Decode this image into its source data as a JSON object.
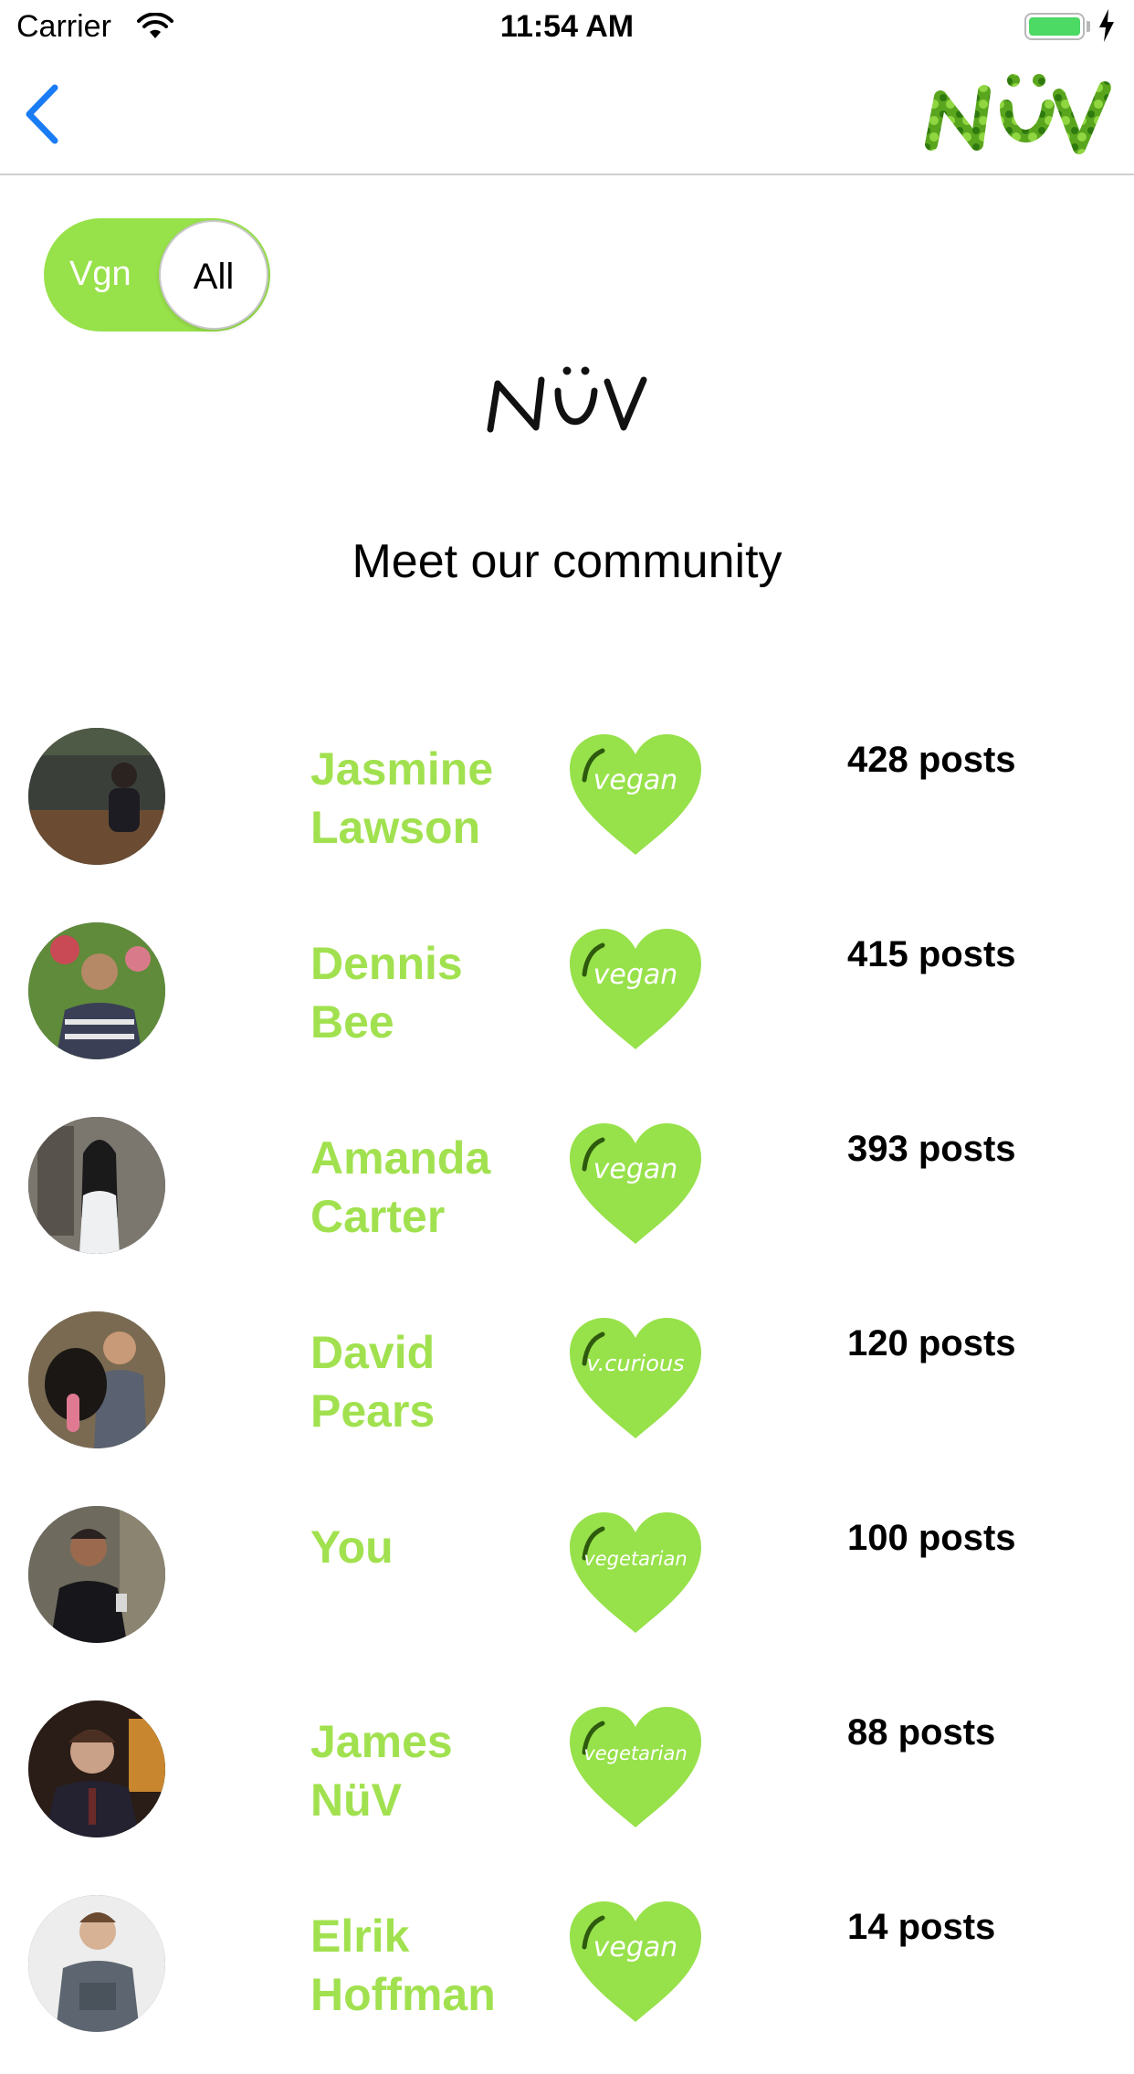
{
  "status_bar": {
    "carrier": "Carrier",
    "time": "11:54 AM"
  },
  "nav": {
    "logo_text": "NüV",
    "back_icon": "chevron-left-icon"
  },
  "toggle": {
    "on_label": "Vgn",
    "off_label": "All",
    "state": "Vgn"
  },
  "brand": {
    "logo_text": "NüV"
  },
  "heading": "Meet our community",
  "colors": {
    "accent": "#97e14a",
    "name_green": "#a1e14f",
    "ios_blue": "#1a7cf5",
    "battery": "#4cd964"
  },
  "members": [
    {
      "first": "Jasmine",
      "last": "Lawson",
      "badge": "vegan",
      "posts": "428 posts"
    },
    {
      "first": "Dennis",
      "last": "Bee",
      "badge": "vegan",
      "posts": "415 posts"
    },
    {
      "first": "Amanda",
      "last": "Carter",
      "badge": "vegan",
      "posts": "393 posts"
    },
    {
      "first": "David",
      "last": "Pears",
      "badge": "v.curious",
      "posts": "120 posts"
    },
    {
      "first": "You",
      "last": "",
      "badge": "vegetarian",
      "posts": "100 posts"
    },
    {
      "first": "James",
      "last": "NüV",
      "badge": "vegetarian",
      "posts": "88 posts"
    },
    {
      "first": "Elrik",
      "last": "Hoffman",
      "badge": "vegan",
      "posts": "14 posts"
    }
  ]
}
